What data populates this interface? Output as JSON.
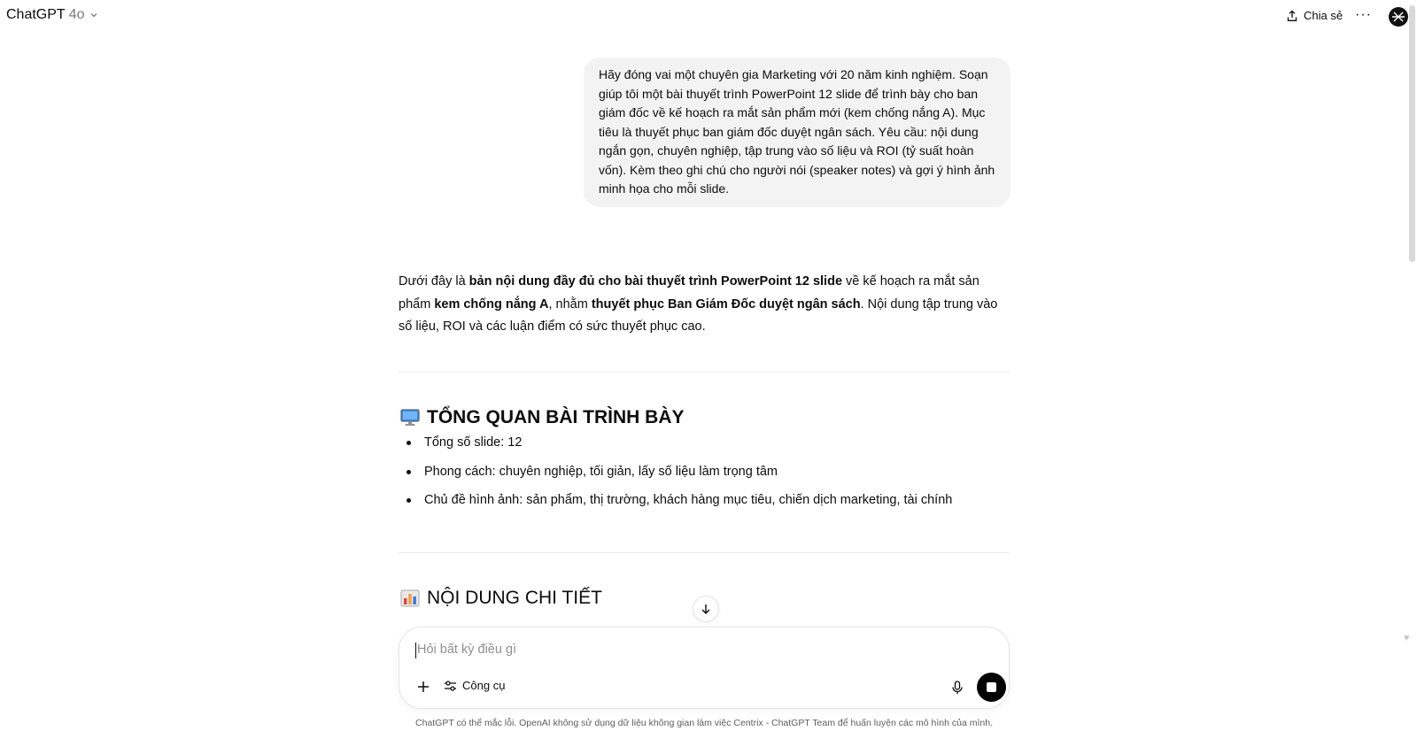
{
  "header": {
    "model_name": "ChatGPT",
    "model_version": "4o",
    "share_label": "Chia sẻ",
    "more_label": "···"
  },
  "conversation": {
    "user_message": "Hãy đóng vai một chuyên gia Marketing với 20 năm kinh nghiệm. Soạn giúp tôi một bài thuyết trình PowerPoint 12 slide để trình bày cho ban giám đốc về kế hoạch ra mắt sản phẩm mới (kem chống nắng A). Mục tiêu là thuyết phục ban giám đốc duyệt ngân sách. Yêu cầu: nội dung ngắn gọn, chuyên nghiệp, tập trung vào số liệu và ROI (tỷ suất hoàn vốn). Kèm theo ghi chú cho người nói (speaker notes) và gợi ý hình ảnh minh họa cho mỗi slide.",
    "answer": {
      "intro": {
        "t1": "Dưới đây là ",
        "b1": "bản nội dung đầy đủ cho bài thuyết trình PowerPoint 12 slide",
        "t2": " về kế hoạch ra mắt sản phẩm ",
        "b2": "kem chống nắng A",
        "t3": ", nhằm ",
        "b3": "thuyết phục Ban Giám Đốc duyệt ngân sách",
        "t4": ". Nội dung tập trung vào số liệu, ROI và các luận điểm có sức thuyết phục cao."
      },
      "section1": {
        "icon": "desktop-computer-icon",
        "title": "TỔNG QUAN BÀI TRÌNH BÀY",
        "bullets": [
          "Tổng số slide: 12",
          "Phong cách: chuyên nghiệp, tối giản, lấy số liệu làm trọng tâm",
          "Chủ đề hình ảnh: sản phẩm, thị trường, khách hàng mục tiêu, chiến dịch marketing, tài chính"
        ]
      },
      "section2": {
        "icon": "bar-chart-icon",
        "title": "NỘI DUNG CHI TIẾT"
      }
    }
  },
  "composer": {
    "placeholder": "Hỏi bất kỳ điều gì",
    "value": "",
    "tools_label": "Công cụ"
  },
  "footer": {
    "disclaimer": "ChatGPT có thể mắc lỗi. OpenAI không sử dụng dữ liệu không gian làm việc Centrix - ChatGPT Team để huấn luyện các mô hình của mình."
  },
  "colors": {
    "user_bubble_bg": "#f3f3f3",
    "text": "#0d0d0d",
    "muted": "#8f8f8f",
    "stop_button": "#000000"
  }
}
